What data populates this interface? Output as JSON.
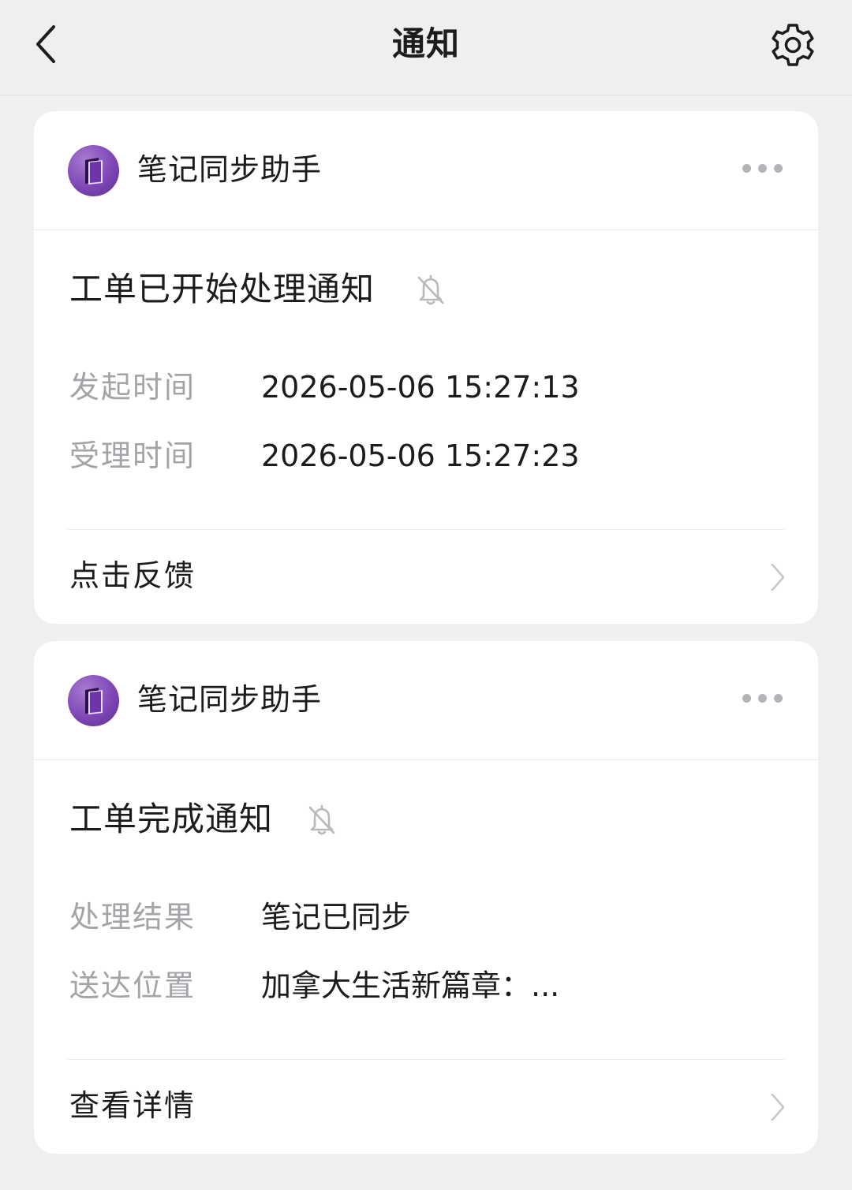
{
  "header": {
    "title": "通知",
    "back_icon": "chevron-left-icon",
    "settings_icon": "gear-icon"
  },
  "cards": [
    {
      "app_name": "笔记同步助手",
      "avatar_icon": "purple-notebook-icon",
      "title": "工单已开始处理通知",
      "fields": [
        {
          "label": "发起时间",
          "value": "2026-05-06 15:27:13"
        },
        {
          "label": "受理时间",
          "value": "2026-05-06 15:27:23"
        }
      ],
      "action_label": "点击反馈"
    },
    {
      "app_name": "笔记同步助手",
      "avatar_icon": "purple-notebook-icon",
      "title": "工单完成通知",
      "fields": [
        {
          "label": "处理结果",
          "value": "笔记已同步"
        },
        {
          "label": "送达位置",
          "value": "加拿大生活新篇章：..."
        }
      ],
      "action_label": "查看详情"
    }
  ],
  "colors": {
    "background": "#efeff1",
    "card": "#ffffff",
    "label_gray": "#a3a3a8",
    "avatar_purple": "#7f47b6"
  }
}
